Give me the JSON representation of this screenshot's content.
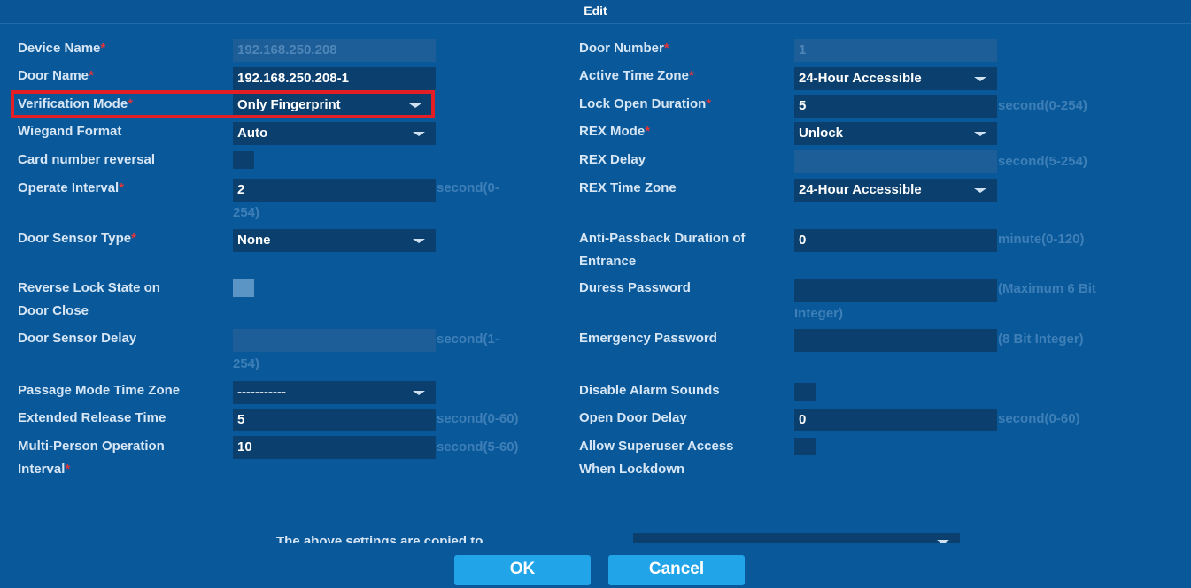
{
  "dialog": {
    "title": "Edit"
  },
  "left": {
    "device_name": {
      "label": "Device Name",
      "value": "192.168.250.208"
    },
    "door_name": {
      "label": "Door Name",
      "value": "192.168.250.208-1"
    },
    "verification_mode": {
      "label": "Verification Mode",
      "value": "Only Fingerprint"
    },
    "wiegand_format": {
      "label": "Wiegand Format",
      "value": "Auto"
    },
    "card_number_reversal": {
      "label": "Card number reversal"
    },
    "operate_interval": {
      "label": "Operate Interval",
      "value": "2",
      "hint_line1": "second(0-",
      "hint_line2": "254)"
    },
    "door_sensor_type": {
      "label": "Door Sensor Type",
      "value": "None"
    },
    "reverse_lock_state": {
      "label_line1": "Reverse Lock State on",
      "label_line2": "Door Close"
    },
    "door_sensor_delay": {
      "label": "Door Sensor Delay",
      "value": "",
      "hint_line1": "second(1-",
      "hint_line2": "254)"
    },
    "passage_mode_time_zone": {
      "label": "Passage Mode Time Zone",
      "value": "-----------"
    },
    "extended_release_time": {
      "label": "Extended Release Time",
      "value": "5",
      "hint": "second(0-60)"
    },
    "multi_person_interval": {
      "label_line1": "Multi-Person Operation",
      "label_line2": "Interval",
      "value": "10",
      "hint": "second(5-60)"
    }
  },
  "right": {
    "door_number": {
      "label": "Door Number",
      "value": "1"
    },
    "active_time_zone": {
      "label": "Active Time Zone",
      "value": "24-Hour Accessible"
    },
    "lock_open_duration": {
      "label": "Lock Open Duration",
      "value": "5",
      "hint": "second(0-254)"
    },
    "rex_mode": {
      "label": "REX Mode",
      "value": "Unlock"
    },
    "rex_delay": {
      "label": "REX Delay",
      "value": "",
      "hint": "second(5-254)"
    },
    "rex_time_zone": {
      "label": "REX Time Zone",
      "value": "24-Hour Accessible"
    },
    "anti_passback_duration": {
      "label_line1": "Anti-Passback Duration of",
      "label_line2": "Entrance",
      "value": "0",
      "hint": "minute(0-120)"
    },
    "duress_password": {
      "label": "Duress Password",
      "value": "",
      "hint_line1": "(Maximum 6 Bit",
      "hint_line2": "Integer)"
    },
    "emergency_password": {
      "label": "Emergency Password",
      "value": "",
      "hint": "(8 Bit Integer)"
    },
    "disable_alarm_sounds": {
      "label": "Disable Alarm Sounds"
    },
    "open_door_delay": {
      "label": "Open Door Delay",
      "value": "0",
      "hint": "second(0-60)"
    },
    "allow_superuser_access": {
      "label_line1": "Allow Superuser Access",
      "label_line2": "When Lockdown"
    }
  },
  "copy_settings": {
    "label": "The above settings are copied to"
  },
  "buttons": {
    "ok": "OK",
    "cancel": "Cancel"
  },
  "required_mark": "*",
  "colors": {
    "background": "#08589a",
    "field": "#0a3f6e",
    "button": "#22a4e8",
    "highlight": "#e31e24",
    "required": "#e0353b"
  }
}
